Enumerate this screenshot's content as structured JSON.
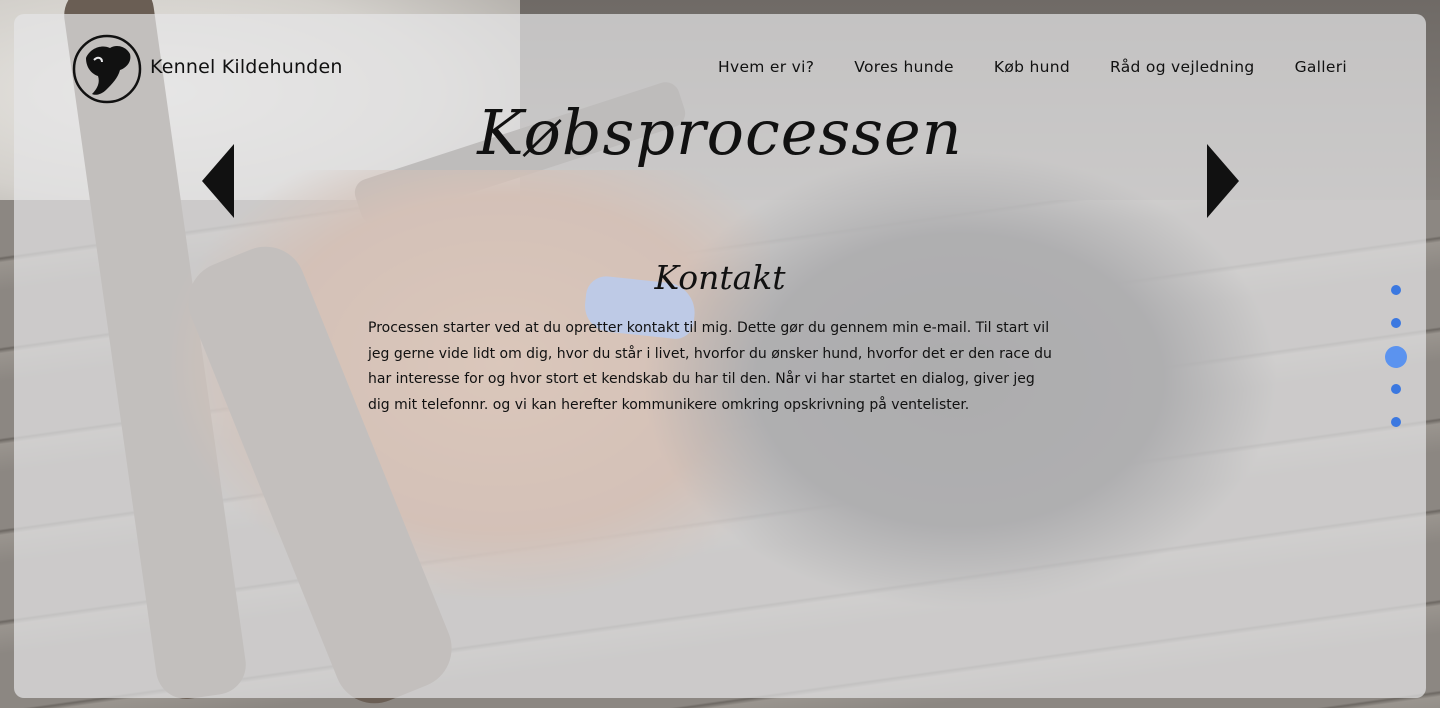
{
  "header": {
    "brand_name": "Kennel Kildehunden",
    "logo_icon": "dog-silhouette-logo"
  },
  "nav": {
    "items": [
      {
        "label": "Hvem er vi?"
      },
      {
        "label": "Vores hunde"
      },
      {
        "label": "Køb hund"
      },
      {
        "label": "Råd og vejledning"
      },
      {
        "label": "Galleri"
      }
    ]
  },
  "hero": {
    "title": "Købsprocessen",
    "prev_icon": "triangle-left-icon",
    "next_icon": "triangle-right-icon"
  },
  "section": {
    "title": "Kontakt",
    "text": "Processen starter ved at du opretter kontakt til mig. Dette gør du gennem min e-mail. Til start vil jeg gerne vide lidt om dig, hvor du står i livet, hvorfor du ønsker hund, hvorfor det er den race du har interesse for og hvor stort et kendskab du har til den. Når vi har startet en dialog, giver jeg dig mit telefonnr. og vi kan herefter kommunikere omkring opskrivning på ventelister."
  },
  "pagination": {
    "total": 5,
    "active_index": 2
  },
  "colors": {
    "accent": "#3b78e0",
    "text": "#111111"
  }
}
